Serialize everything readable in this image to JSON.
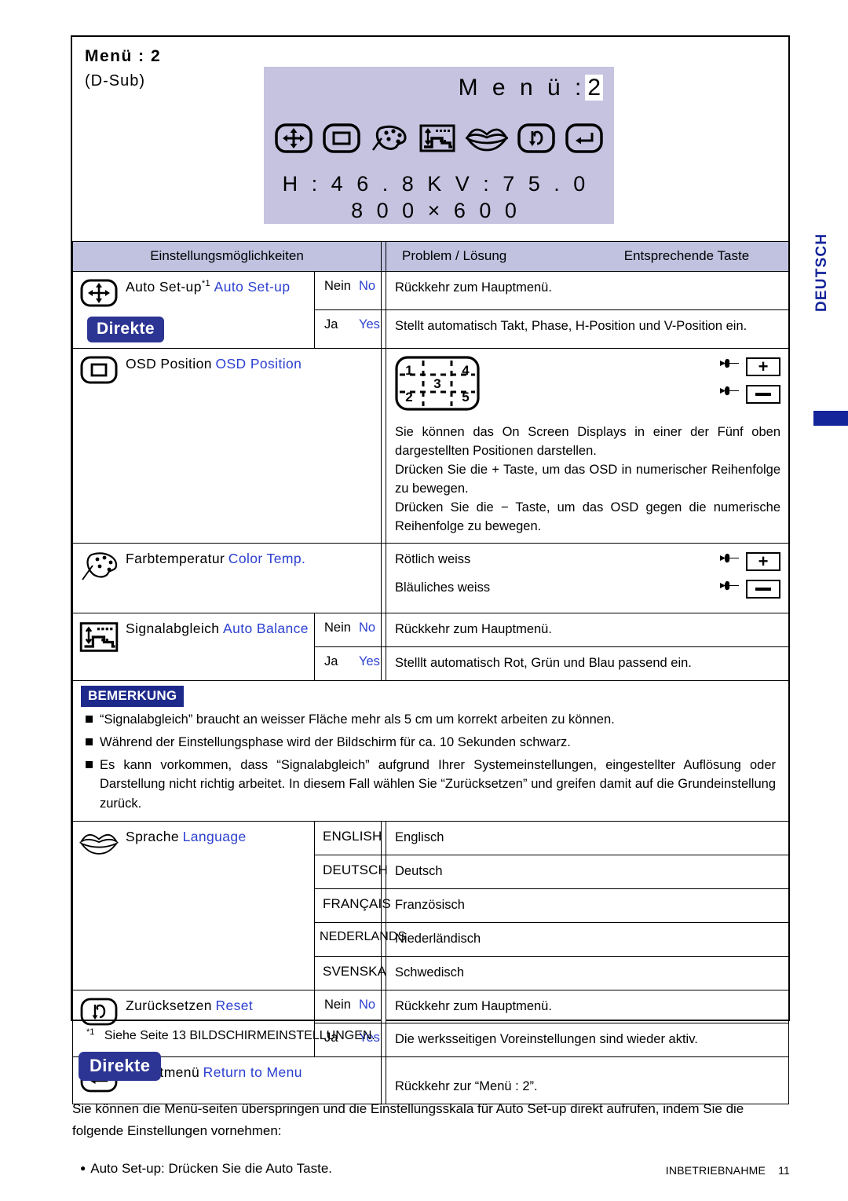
{
  "header": {
    "title": "Menü : 2",
    "subtitle": "(D-Sub)"
  },
  "osd": {
    "title_label": "M e n ü :",
    "title_value": "2",
    "icons": [
      "position-arrows-icon",
      "osd-position-icon",
      "color-palette-icon",
      "auto-balance-icon",
      "language-lips-icon",
      "reset-icon",
      "return-to-menu-icon"
    ],
    "line1": "H : 4 6 . 8 K   V : 7 5 . 0",
    "line2": "8 0 0  ×  6 0 0"
  },
  "table": {
    "headers": {
      "settings": "Einstellungsmöglichkeiten",
      "problem": "Problem / Lösung",
      "button": "Entsprechende Taste"
    },
    "rows": [
      {
        "icon": "position-arrows-icon",
        "label_de": "Auto Set-up",
        "label_de_sup": "*1",
        "label_en": "Auto Set-up",
        "badge": "Direkte",
        "options": [
          {
            "de": "Nein",
            "en": "No",
            "desc": "Rückkehr zum Hauptmenü."
          },
          {
            "de": "Ja",
            "en": "Yes",
            "desc": "Stellt automatisch Takt, Phase, H-Position und V-Position ein."
          }
        ]
      },
      {
        "icon": "osd-position-icon",
        "label_de": "OSD Position",
        "label_en": "OSD Position",
        "diagram": {
          "cells": [
            "1",
            "4",
            "3",
            "2",
            "5"
          ]
        },
        "keys": [
          "+",
          "−"
        ],
        "desc_lines": [
          "Sie können das On Screen Displays in einer der Fünf oben dargestellten Positionen darstellen.",
          "Drücken Sie die + Taste, um das OSD in numerischer Reihenfolge zu bewegen.",
          "Drücken Sie die − Taste, um das OSD gegen die numerische Reihenfolge zu bewegen."
        ]
      },
      {
        "icon": "color-palette-icon",
        "label_de": "Farbtemperatur",
        "label_en": "Color Temp.",
        "keys": [
          "+",
          "−"
        ],
        "options": [
          {
            "desc": "Rötlich weiss"
          },
          {
            "desc": "Bläuliches weiss"
          }
        ]
      },
      {
        "icon": "auto-balance-icon",
        "label_de": "Signalabgleich",
        "label_en": "Auto Balance",
        "options": [
          {
            "de": "Nein",
            "en": "No",
            "desc": "Rückkehr zum Hauptmenü."
          },
          {
            "de": "Ja",
            "en": "Yes",
            "desc": "Stelllt automatisch Rot, Grün und Blau passend ein."
          }
        ]
      },
      {
        "icon": "language-lips-icon",
        "label_de": "Sprache",
        "label_en": "Language",
        "languages": [
          {
            "code": "ENGLISH",
            "name": "Englisch"
          },
          {
            "code": "DEUTSCH",
            "name": "Deutsch"
          },
          {
            "code": "FRANÇAIS",
            "name": "Französisch"
          },
          {
            "code": "NEDERLANDS",
            "name": "Niederländisch"
          },
          {
            "code": "SVENSKA",
            "name": "Schwedisch"
          }
        ]
      },
      {
        "icon": "reset-icon",
        "label_de": "Zurücksetzen",
        "label_en": "Reset",
        "options": [
          {
            "de": "Nein",
            "en": "No",
            "desc": "Rückkehr zum Hauptmenü."
          },
          {
            "de": "Ja",
            "en": "Yes",
            "desc": "Die werksseitigen Voreinstellungen sind wieder aktiv."
          }
        ]
      },
      {
        "icon": "return-to-menu-icon",
        "label_de": "Hauptmenü",
        "label_en": "Return to Menu",
        "options": [
          {
            "desc": "Rückkehr zur “Menü : 2”."
          }
        ]
      }
    ]
  },
  "bemerkung": {
    "badge": "BEMERKUNG",
    "items": [
      "“Signalabgleich” braucht an weisser Fläche mehr als 5 cm um korrekt arbeiten zu können.",
      "Während der Einstellungsphase wird der Bildschirm für ca. 10 Sekunden schwarz.",
      "Es kann vorkommen, dass “Signalabgleich”  aufgrund Ihrer Systemeinstellungen, eingestellter Auflösung oder Darstellung nicht richtig arbeitet. In diesem Fall wählen Sie “Zurücksetzen” und greifen damit auf die Grundeinstellung zurück."
    ]
  },
  "footer": {
    "footnote_sup": "*1",
    "footnote": "Siehe Seite 13 BILDSCHIRMEINSTELLUNGEN.",
    "direkte_badge": "Direkte",
    "paragraph": "Sie können die Menü-seiten überspringen und die Einstellungsskala für Auto Set-up direkt aufrufen, indem Sie die folgende Einstellungen vornehmen:",
    "bullet": "Auto Set-up: Drücken Sie die Auto Taste.",
    "page_label": "INBETRIEBNAHME",
    "page_number": "11"
  },
  "side_tab": {
    "label": "DEUTSCH"
  },
  "colors": {
    "osd_background": "#c5c3e0",
    "table_header": "#c0c2e0",
    "accent_blue": "#2b3fd0",
    "badge_blue": "#2d3594",
    "bemerkung_blue": "#1d2a8c",
    "side_tab_blue": "#14249a"
  }
}
